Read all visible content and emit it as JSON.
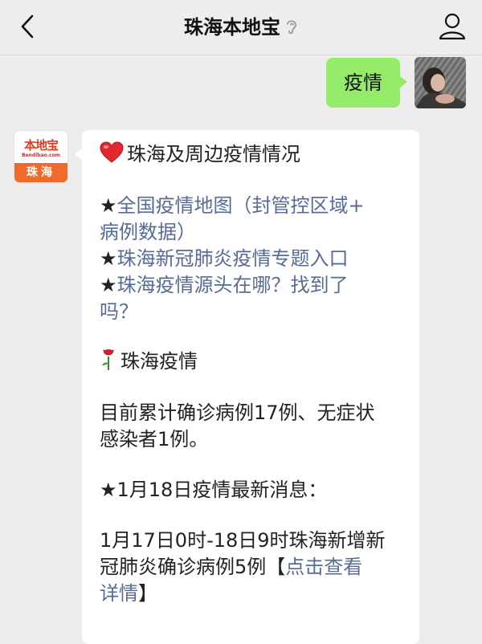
{
  "nav": {
    "title": "珠海本地宝"
  },
  "chat": {
    "my_message": "疫情",
    "account_avatar": {
      "brand": "本地宝",
      "domain": "Bendibao.com",
      "city": "珠海"
    },
    "reply": {
      "heading": "珠海及周边疫情情况",
      "link1_prefix": "★",
      "link1_line1": "全国疫情地图（封管控区域+",
      "link1_line2": "病例数据）",
      "link2_prefix": "★",
      "link2": "珠海新冠肺炎疫情专题入口",
      "link3_prefix": "★",
      "link3_line1": "珠海疫情源头在哪？找到了",
      "link3_line2": "吗？",
      "section_title": "珠海疫情",
      "summary_line1": "目前累计确诊病例17例、无症状",
      "summary_line2": "感染者1例。",
      "news_title": "★1月18日疫情最新消息：",
      "news_line1": "1月17日0时-18日9时珠海新增新",
      "news_line2_text": "冠肺炎确诊病例5例【",
      "news_line2_link": "点击查看",
      "news_line3_link": "详情",
      "news_line3_end": "】"
    }
  },
  "colors": {
    "page_bg": "#ededed",
    "my_bubble": "#95ec69",
    "link": "#576b95"
  }
}
